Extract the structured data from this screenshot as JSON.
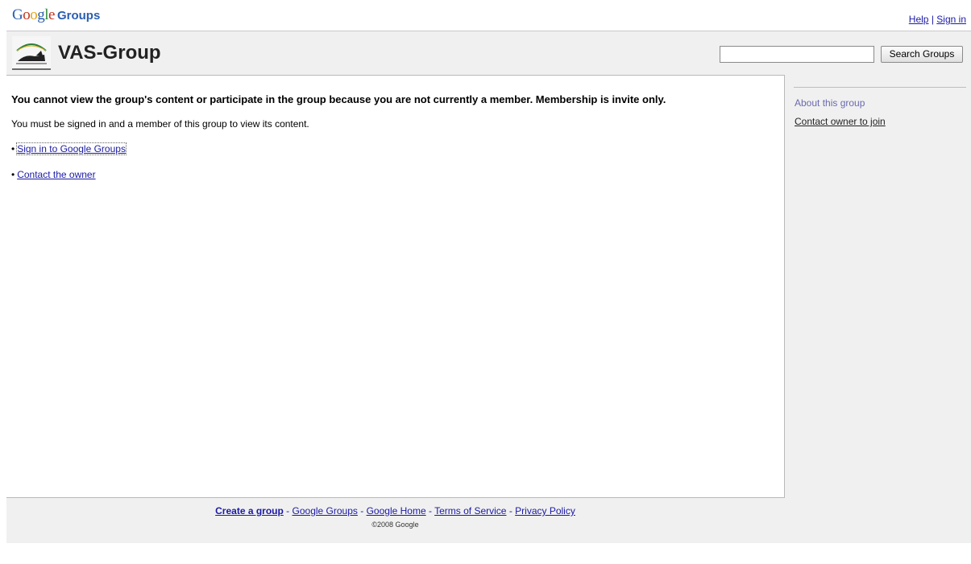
{
  "top": {
    "logo_text": "Google",
    "logo_groups": "Groups",
    "help_label": "Help",
    "separator": "|",
    "signin_label": "Sign in"
  },
  "header": {
    "group_title": "VAS-Group",
    "search_value": "",
    "search_button_label": "Search Groups"
  },
  "main": {
    "message_bold": "You cannot view the group's content or participate in the group because you are not currently a member.  Membership is invite only.",
    "message_normal": "You must be signed in and a member of this group to view its content.",
    "bullet": "•",
    "link_signin": "Sign in to Google Groups",
    "link_contact": "Contact the owner"
  },
  "sidebar": {
    "about_label": "About this group",
    "contact_join_label": "Contact owner to join"
  },
  "footer": {
    "links": [
      "Create a group",
      "Google Groups",
      "Google Home",
      "Terms of Service",
      "Privacy Policy"
    ],
    "separator": "-",
    "copyright": "©2008 Google"
  },
  "colors": {
    "link": "#1a1aa6",
    "google_blue": "#2a5db0",
    "band_grey": "#f0f0f0"
  }
}
